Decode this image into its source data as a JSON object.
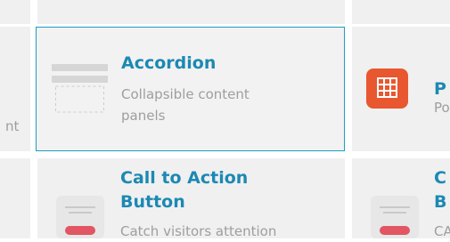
{
  "widgets": {
    "left_partial_desc_end": "nt",
    "accordion": {
      "title": "Accordion",
      "desc_line1": "Collapsible content",
      "desc_line2": "panels"
    },
    "right_top": {
      "title_partial": "P",
      "desc_partial": "Po"
    },
    "cta": {
      "title_line1": "Call to Action",
      "title_line2": "Button",
      "desc_line1": "Catch visitors attention"
    },
    "right_bottom": {
      "title_line1_partial": "C",
      "title_line2_partial": "B",
      "desc_partial": "CA"
    }
  },
  "icons": {
    "accordion": "accordion-icon",
    "pricing": "table-grid-icon",
    "cta": "button-icon"
  },
  "colors": {
    "accent": "#1c89b3",
    "selected_border": "#1c9fc1",
    "icon_orange": "#e8572f",
    "icon_red": "#e25563",
    "muted_text": "#9e9e9e",
    "tile_bg": "#f0f0f0"
  }
}
